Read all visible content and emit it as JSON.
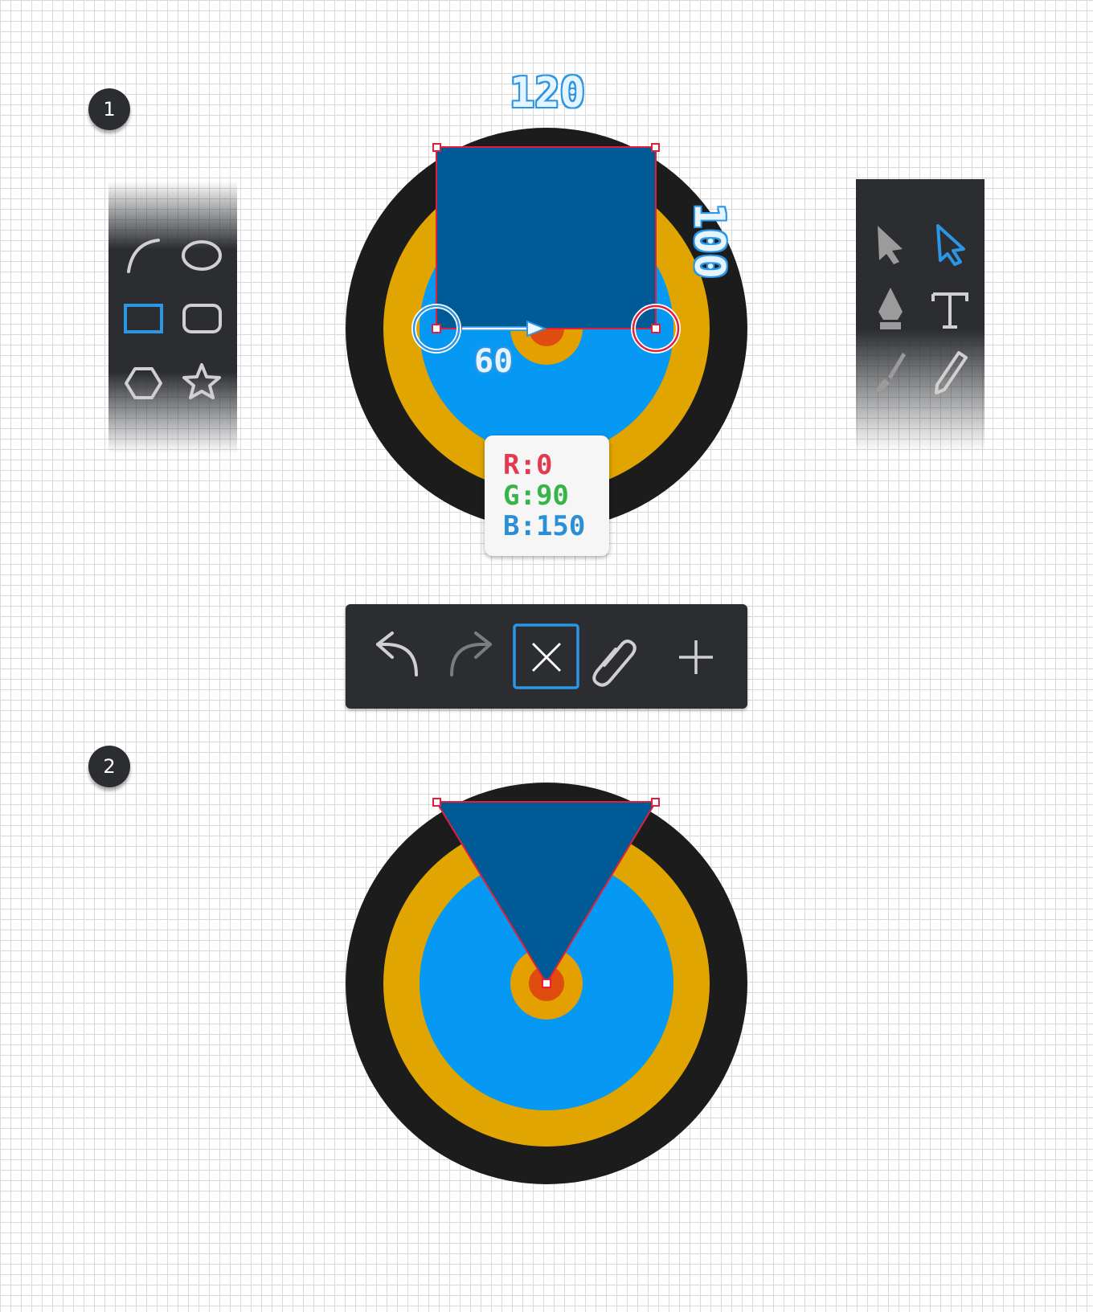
{
  "steps": [
    {
      "number": "1"
    },
    {
      "number": "2"
    }
  ],
  "dimensions": {
    "width": "120",
    "height": "100",
    "offset": "60"
  },
  "fill_color": {
    "r_label": "R:0",
    "g_label": "G:90",
    "b_label": "B:150",
    "hex": "#005a96"
  },
  "shape_tools": {
    "items": [
      "arc-tool",
      "ellipse-tool",
      "rectangle-tool",
      "rounded-rectangle-tool",
      "polygon-tool",
      "star-tool"
    ],
    "active": "rectangle-tool"
  },
  "select_tools": {
    "items": [
      "selection-tool",
      "direct-selection-tool",
      "pen-tool",
      "type-tool",
      "brush-tool",
      "pencil-tool"
    ],
    "active": "direct-selection-tool"
  },
  "action_toolbar": {
    "items": [
      "undo",
      "redo",
      "delete-anchor",
      "attach",
      "add"
    ],
    "active": "delete-anchor"
  },
  "colors": {
    "ring_outer": "#1c1c1c",
    "ring_yellow": "#e0a500",
    "disc_blue": "#0699f3",
    "center_orange": "#e4a000",
    "center_red": "#e04c0f",
    "shape_fill": "#005a96",
    "accent_blue": "#2b96e6",
    "anchor_red": "#e31e3a"
  }
}
